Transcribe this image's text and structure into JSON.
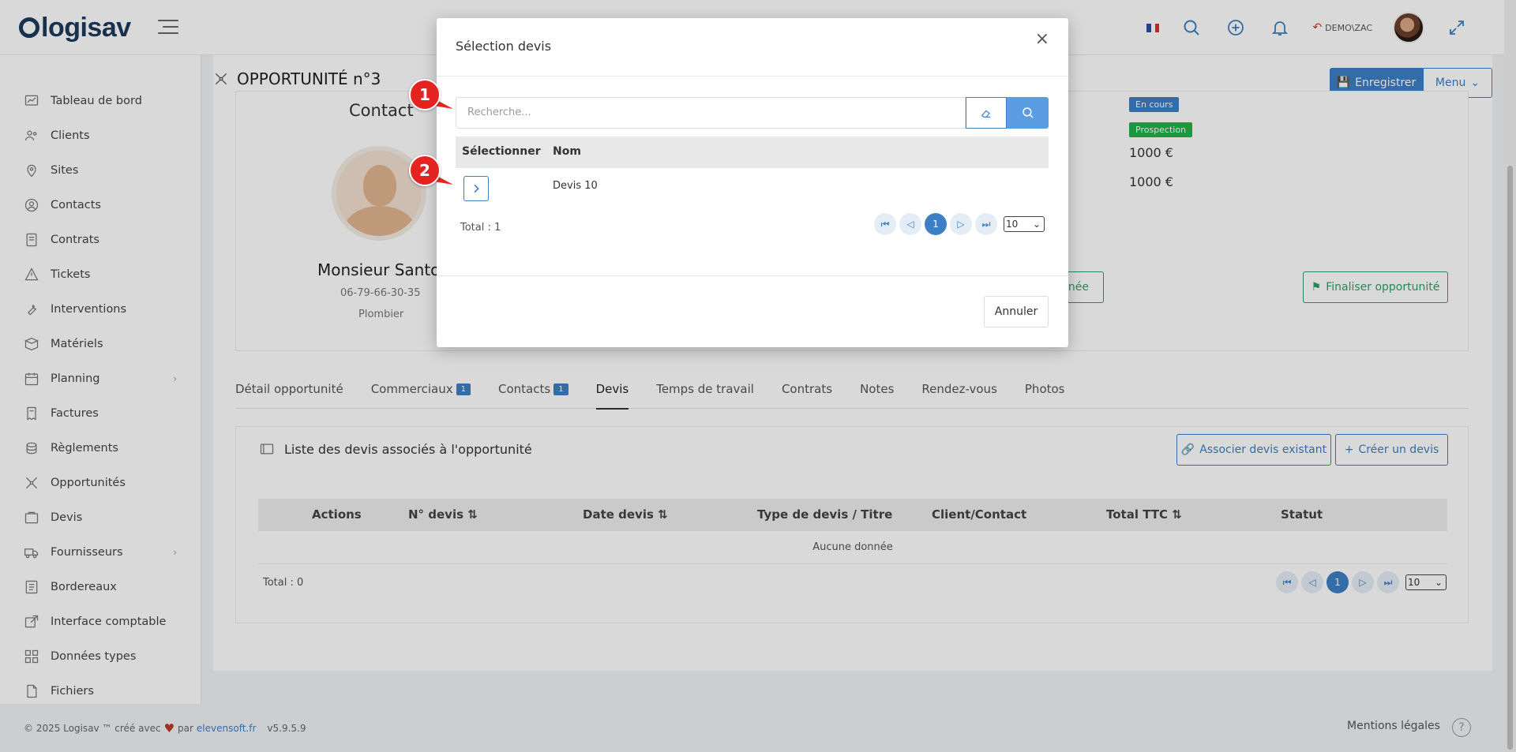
{
  "app": {
    "brand": "logisav",
    "user": "DEMO\\ZAC"
  },
  "colors": {
    "primary": "#3d7fc4",
    "success": "#2e9e6a",
    "badge_blue": "#3d7fc4",
    "badge_green": "#1fb34a",
    "marker": "#e52421"
  },
  "sidebar": {
    "items": [
      {
        "label": "Tableau de bord",
        "icon": "dashboard-icon"
      },
      {
        "label": "Clients",
        "icon": "users-icon"
      },
      {
        "label": "Sites",
        "icon": "map-pin-icon"
      },
      {
        "label": "Contacts",
        "icon": "contacts-icon"
      },
      {
        "label": "Contrats",
        "icon": "contract-icon"
      },
      {
        "label": "Tickets",
        "icon": "warning-icon"
      },
      {
        "label": "Interventions",
        "icon": "wrench-icon"
      },
      {
        "label": "Matériels",
        "icon": "package-icon"
      },
      {
        "label": "Planning",
        "icon": "calendar-icon",
        "chevron": "›"
      },
      {
        "label": "Factures",
        "icon": "invoice-icon"
      },
      {
        "label": "Règlements",
        "icon": "coins-icon"
      },
      {
        "label": "Opportunités",
        "icon": "opportunity-icon"
      },
      {
        "label": "Devis",
        "icon": "quote-icon"
      },
      {
        "label": "Fournisseurs",
        "icon": "truck-icon",
        "chevron": "›"
      },
      {
        "label": "Bordereaux",
        "icon": "list-icon"
      },
      {
        "label": "Interface comptable",
        "icon": "external-link-icon"
      },
      {
        "label": "Données types",
        "icon": "grid-icon"
      },
      {
        "label": "Fichiers",
        "icon": "file-icon"
      }
    ]
  },
  "header": {
    "title": "OPPORTUNITÉ n°3",
    "save_label": "Enregistrer",
    "menu_label": "Menu"
  },
  "contact": {
    "title": "Contact",
    "name": "Monsieur Santo",
    "phone": "06-79-66-30-35",
    "job": "Plombier"
  },
  "status": {
    "badge1": "En cours",
    "badge2": "Prospection",
    "amount1": "1000 €",
    "amount2": "1000 €",
    "partial_button": "inée",
    "finalize_label": "Finaliser opportunité"
  },
  "tabs": [
    {
      "label": "Détail opportunité",
      "count": ""
    },
    {
      "label": "Commerciaux",
      "count": "1"
    },
    {
      "label": "Contacts",
      "count": "1"
    },
    {
      "label": "Devis",
      "count": "",
      "active": true
    },
    {
      "label": "Temps de travail",
      "count": ""
    },
    {
      "label": "Contrats",
      "count": ""
    },
    {
      "label": "Notes",
      "count": ""
    },
    {
      "label": "Rendez-vous",
      "count": ""
    },
    {
      "label": "Photos",
      "count": ""
    }
  ],
  "devis_section": {
    "title": "Liste des devis associés à l'opportunité",
    "associate_label": "Associer devis existant",
    "create_label": "Créer un devis",
    "columns": [
      "Actions",
      "N° devis ⇅",
      "Date devis ⇅",
      "Type de devis / Titre",
      "Client/Contact",
      "Total TTC ⇅",
      "Statut"
    ],
    "empty": "Aucune donnée",
    "total": "Total : 0",
    "page": "1",
    "page_size": "10"
  },
  "modal": {
    "title": "Sélection devis",
    "search_placeholder": "Recherche...",
    "columns": [
      "Sélectionner",
      "Nom"
    ],
    "rows": [
      {
        "name": "Devis 10"
      }
    ],
    "total": "Total : 1",
    "page": "1",
    "page_size": "10",
    "cancel_label": "Annuler"
  },
  "markers": [
    "1",
    "2"
  ],
  "footer": {
    "copyright": "© 2025 Logisav ™ créé avec",
    "by": "par",
    "link": "elevensoft.fr",
    "version": "v5.9.5.9",
    "legal": "Mentions légales",
    "help": "?"
  }
}
